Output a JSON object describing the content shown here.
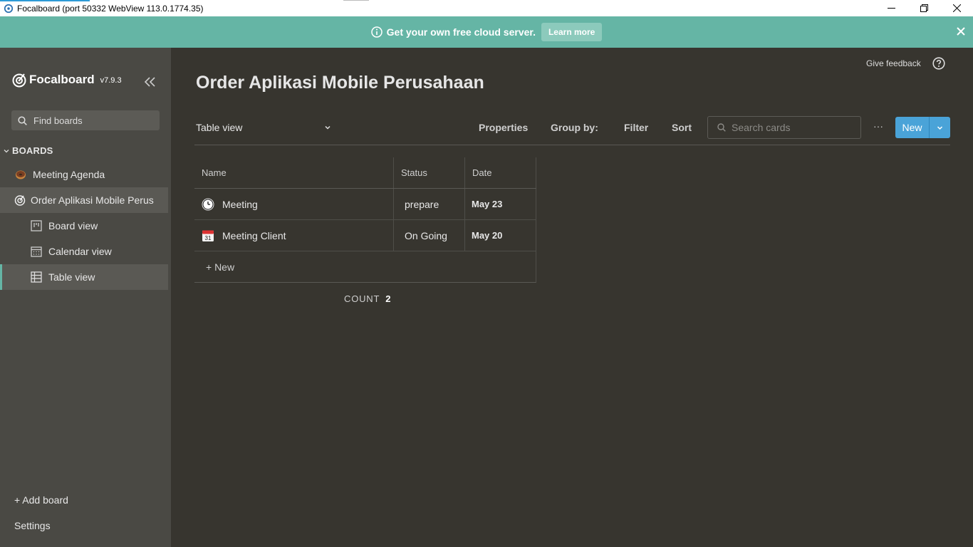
{
  "window": {
    "title": "Focalboard (port 50332 WebView 113.0.1774.35)"
  },
  "banner": {
    "message": "Get your own free cloud server.",
    "learn_more": "Learn more"
  },
  "sidebar": {
    "brand": "Focalboard",
    "version": "v7.9.3",
    "search_placeholder": "Find boards",
    "boards_header": "BOARDS",
    "items": [
      {
        "label": "Meeting Agenda",
        "icon": "donut-emoji-icon"
      },
      {
        "label": "Order Aplikasi Mobile Perus",
        "icon": "focalboard-icon"
      },
      {
        "label": "Board view",
        "icon": "board-view-icon"
      },
      {
        "label": "Calendar view",
        "icon": "calendar-view-icon"
      },
      {
        "label": "Table view",
        "icon": "table-view-icon"
      }
    ],
    "add_board": "+ Add board",
    "settings": "Settings"
  },
  "header": {
    "feedback": "Give feedback",
    "title": "Order Aplikasi Mobile Perusahaan"
  },
  "toolbar": {
    "view": "Table view",
    "properties": "Properties",
    "group_by": "Group by:",
    "filter": "Filter",
    "sort": "Sort",
    "search_placeholder": "Search cards",
    "more": "···",
    "new": "New"
  },
  "table": {
    "columns": [
      "Name",
      "Status",
      "Date"
    ],
    "rows": [
      {
        "name": "Meeting",
        "status": "prepare",
        "date": "May 23",
        "icon": "clock-icon"
      },
      {
        "name": "Meeting Client",
        "status": "On Going",
        "date": "May 20",
        "icon": "calendar-icon"
      }
    ],
    "add_row": "+ New",
    "count_label": "COUNT",
    "count_value": "2"
  },
  "colors": {
    "accent": "#65b5a5",
    "button": "#4aa3d8",
    "background": "#37352f",
    "sidebar": "#4a4944"
  }
}
